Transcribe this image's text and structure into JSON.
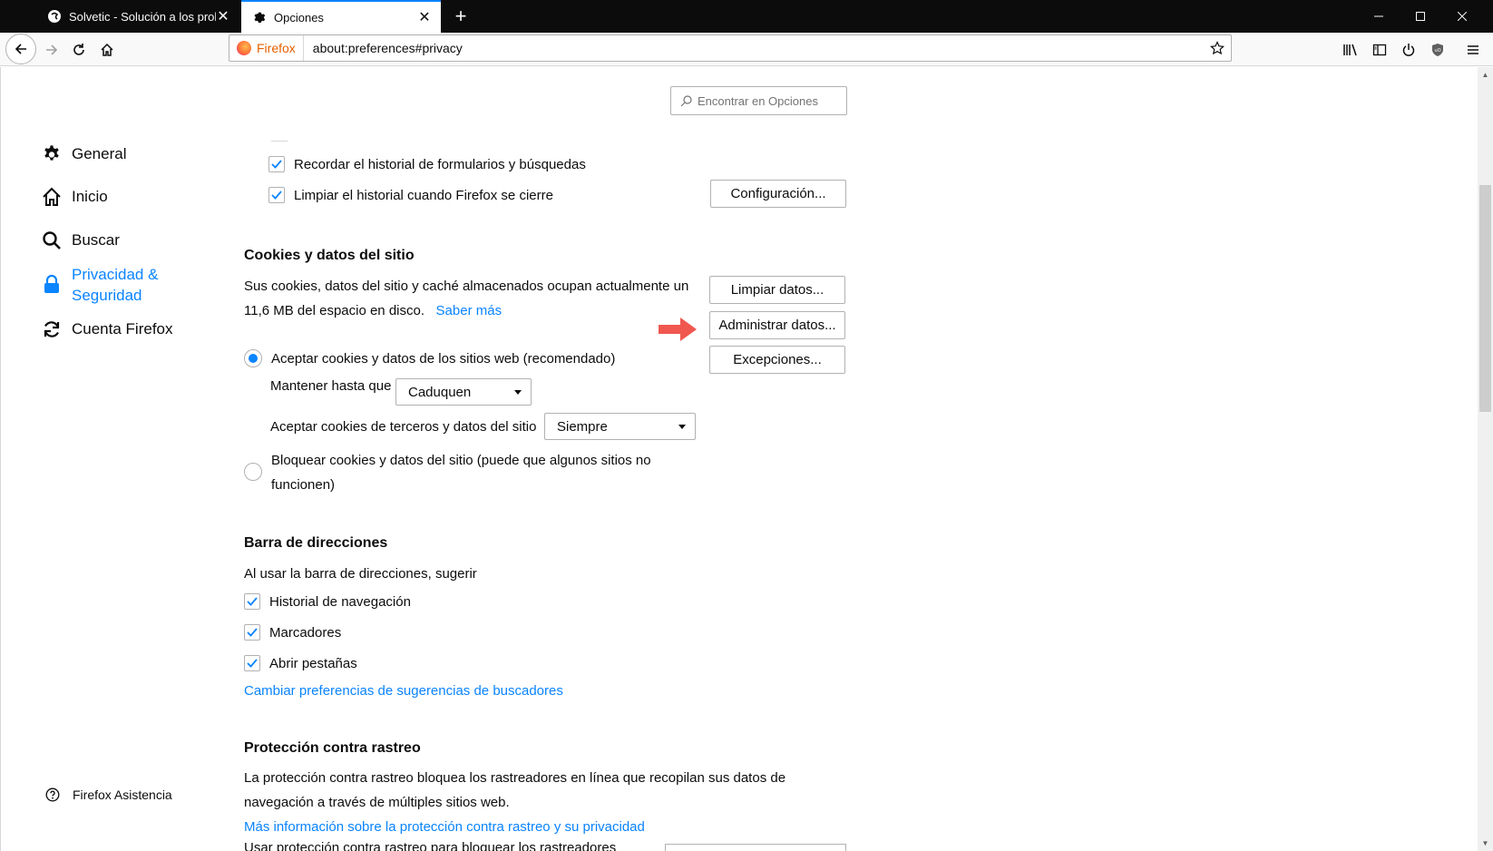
{
  "tabs": [
    {
      "title": "Solvetic - Solución a los proble",
      "close": "✕"
    },
    {
      "title": "Opciones",
      "close": "✕"
    }
  ],
  "newtab": "+",
  "urlbar": {
    "identity": "Firefox",
    "url": "about:preferences#privacy"
  },
  "search": {
    "placeholder": "Encontrar en Opciones"
  },
  "sidebar": {
    "items": [
      {
        "label": "General",
        "icon": "gear-icon"
      },
      {
        "label": "Inicio",
        "icon": "home-icon"
      },
      {
        "label": "Buscar",
        "icon": "search-icon"
      },
      {
        "label_line1": "Privacidad &",
        "label_line2": "Seguridad",
        "icon": "lock-icon",
        "selected": true
      },
      {
        "label": "Cuenta Firefox",
        "icon": "sync-icon"
      }
    ],
    "help": "Firefox Asistencia"
  },
  "history": {
    "remember_forms": {
      "label": "Recordar el historial de formularios y búsquedas",
      "checked": true
    },
    "clear_on_close": {
      "label": "Limpiar el historial cuando Firefox se cierre",
      "checked": true
    },
    "settings_button": "Configuración..."
  },
  "cookies": {
    "heading": "Cookies y datos del sitio",
    "desc_line1": "Sus cookies, datos del sitio y caché almacenados ocupan actualmente un",
    "desc_line2": "11,6 MB del espacio en disco.",
    "learn_more": "Saber más",
    "clear_button": "Limpiar datos...",
    "manage_button": "Administrar datos...",
    "exceptions_button": "Excepciones...",
    "accept_radio": "Aceptar cookies y datos de los sitios web (recomendado)",
    "keep_until_label": "Mantener hasta que",
    "keep_until_value": "Caduquen",
    "third_party_label": "Aceptar cookies de terceros y datos del sitio",
    "third_party_value": "Siempre",
    "block_radio_line1": "Bloquear cookies y datos del sitio (puede que algunos sitios no",
    "block_radio_line2": "funcionen)"
  },
  "addressbar": {
    "heading": "Barra de direcciones",
    "desc": "Al usar la barra de direcciones, sugerir",
    "history": "Historial de navegación",
    "bookmarks": "Marcadores",
    "open_tabs": "Abrir pestañas",
    "change_link": "Cambiar preferencias de sugerencias de buscadores"
  },
  "tracking": {
    "heading": "Protección contra rastreo",
    "desc_line1": "La protección contra rastreo bloquea los rastreadores en línea que recopilan sus datos de",
    "desc_line2": "navegación a través de múltiples sitios web.",
    "more_link": "Más información sobre la protección contra rastreo y su privacidad",
    "partial": "Usar protección contra rastreo para bloquear los rastreadores"
  },
  "colors": {
    "accent": "#0a84ff",
    "arrow": "#f0574f"
  }
}
